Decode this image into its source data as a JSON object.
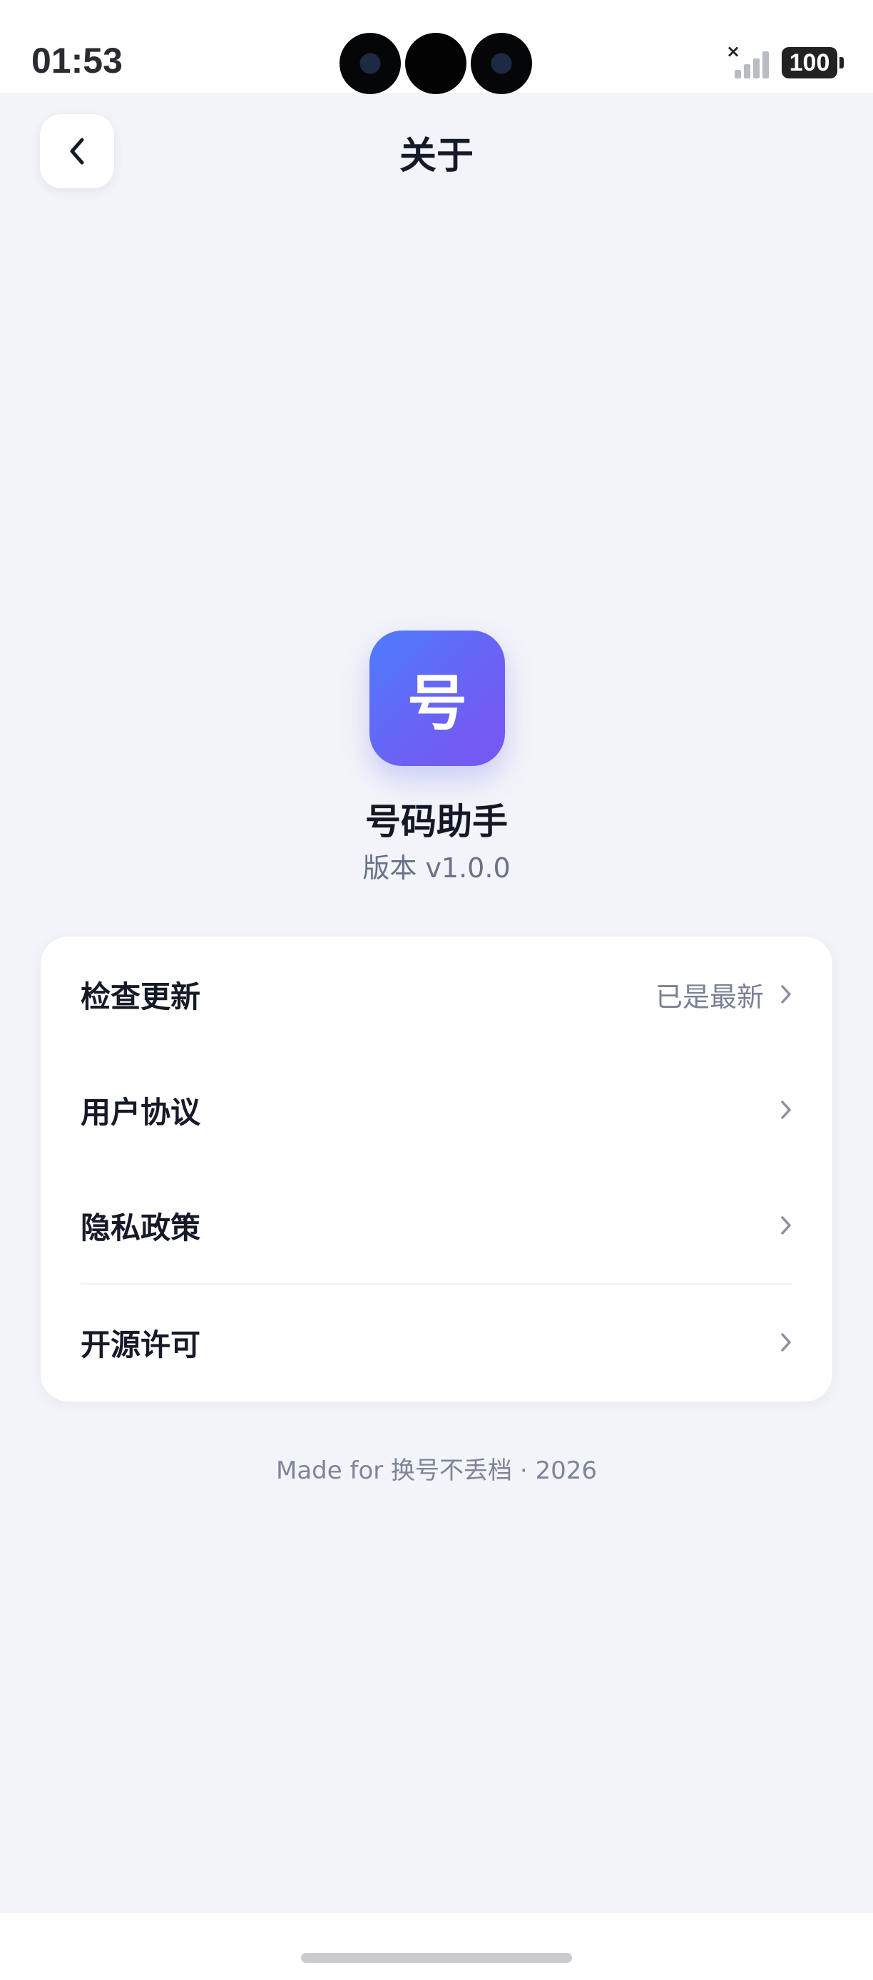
{
  "status_bar": {
    "time": "01:53",
    "battery": "100",
    "signal_icon": "signal-off-icon"
  },
  "nav": {
    "back_icon": "chevron-left-icon",
    "title": "关于"
  },
  "app": {
    "icon_glyph": "号",
    "name": "号码助手",
    "version": "版本 v1.0.0",
    "icon_gradient": [
      "#4d7cfe",
      "#7a55f2"
    ]
  },
  "menu": {
    "items": [
      {
        "label": "检查更新",
        "value": "已是最新"
      },
      {
        "label": "用户协议",
        "value": ""
      },
      {
        "label": "隐私政策",
        "value": ""
      },
      {
        "label": "开源许可",
        "value": ""
      }
    ]
  },
  "footer": "Made for 换号不丢档 · 2026",
  "colors": {
    "background": "#f3f4f9",
    "card": "#ffffff",
    "text_primary": "#141826",
    "text_secondary": "#6b7287"
  }
}
